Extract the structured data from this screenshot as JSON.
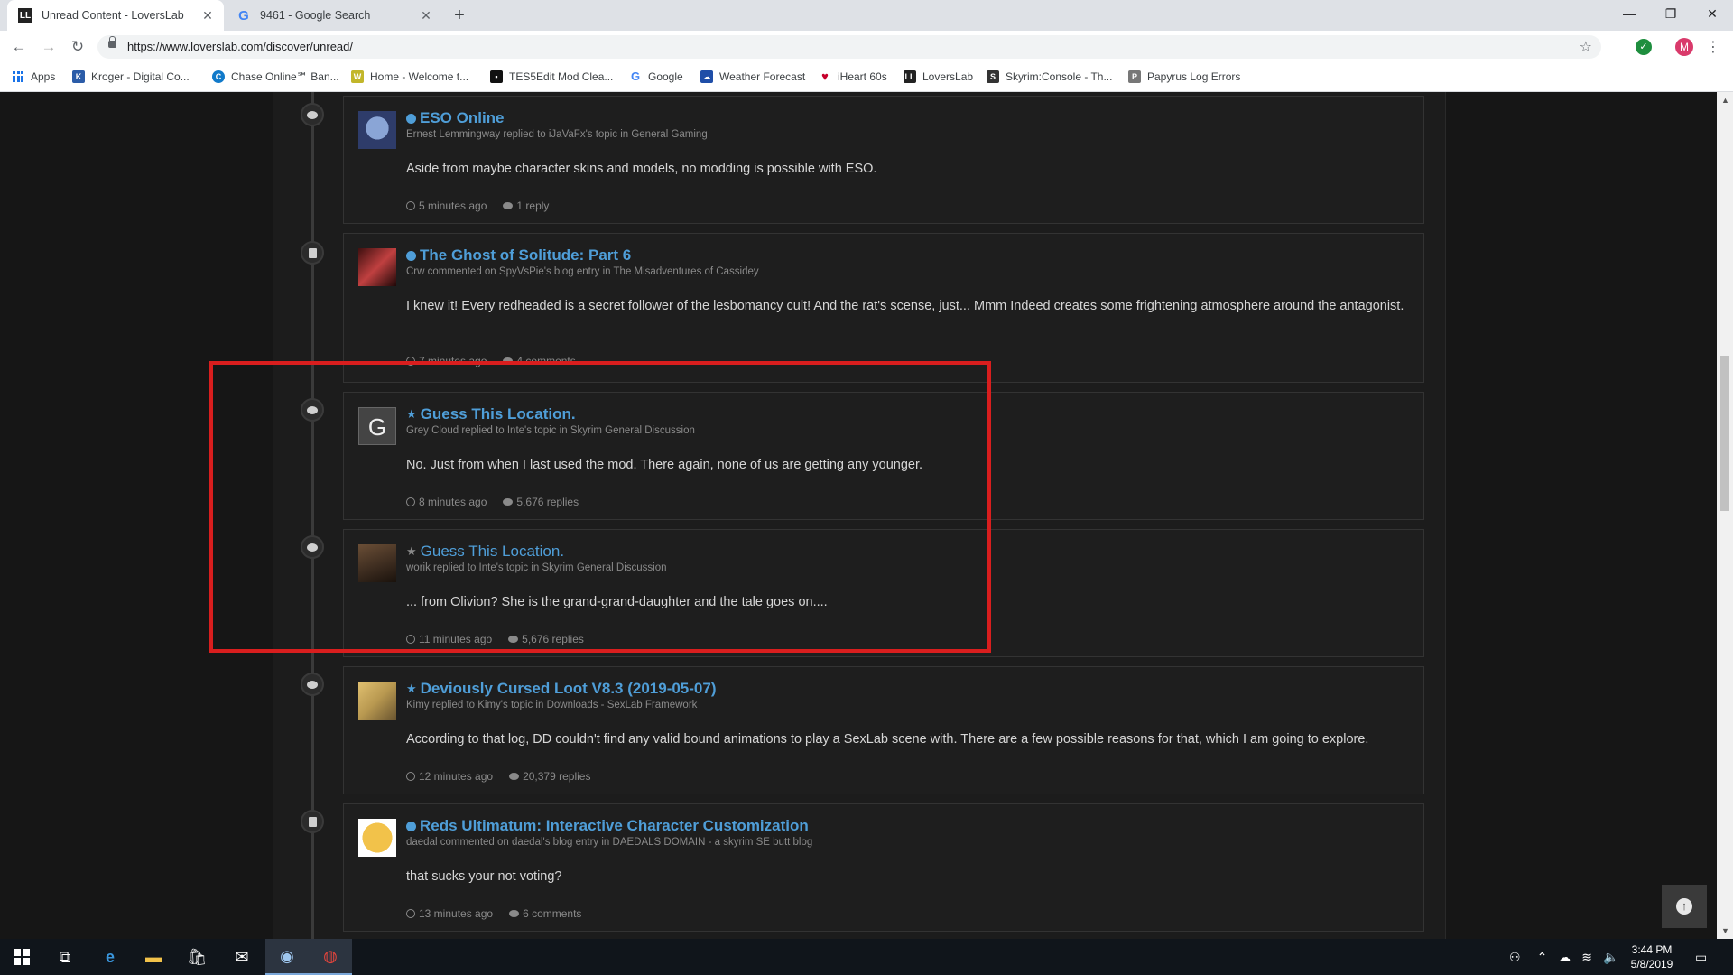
{
  "browser": {
    "tabs": [
      {
        "title": "Unread Content - LoversLab",
        "icon": "loverslab-favicon",
        "active": true
      },
      {
        "title": "9461 - Google Search",
        "icon": "google-favicon",
        "active": false
      }
    ],
    "url": "https://www.loverslab.com/discover/unread/",
    "profile_initial": "M",
    "bookmarks": [
      {
        "label": "Apps"
      },
      {
        "label": "Kroger - Digital Co..."
      },
      {
        "label": "Chase Online℠ Ban..."
      },
      {
        "label": "Home - Welcome t..."
      },
      {
        "label": "TES5Edit Mod Clea..."
      },
      {
        "label": "Google"
      },
      {
        "label": "Weather Forecast"
      },
      {
        "label": "iHeart 60s"
      },
      {
        "label": "LoversLab"
      },
      {
        "label": "Skyrim:Console - Th..."
      },
      {
        "label": "Papyrus Log Errors"
      }
    ]
  },
  "feed": {
    "items": [
      {
        "type": "comment",
        "marker": "unread-dot",
        "title": "ESO Online",
        "meta": "Ernest Lemmingway replied to iJaVaFx's topic in General Gaming",
        "snippet": "Aside from maybe character skins and models, no modding is possible with ESO.",
        "time": "5 minutes ago",
        "replies": "1 reply"
      },
      {
        "type": "blog",
        "marker": "unread-dot",
        "title": "The Ghost of Solitude: Part 6",
        "meta": "Crw commented on SpyVsPie's blog entry in The Misadventures of Cassidey",
        "snippet": "I knew it! Every redheaded is a secret follower of the lesbomancy cult! And the rat's scense, just... Mmm Indeed creates some frightening atmosphere around the antagonist.",
        "time": "7 minutes ago",
        "replies": "4 comments"
      },
      {
        "type": "comment",
        "marker": "star",
        "title": "Guess This Location.",
        "avatar_letter": "G",
        "meta": "Grey Cloud replied to Inte's topic in Skyrim General Discussion",
        "snippet": "No. Just from when I last used the mod. There again, none of us are getting any younger.",
        "time": "8 minutes ago",
        "replies": "5,676 replies"
      },
      {
        "type": "comment",
        "marker": "star",
        "title": "Guess This Location.",
        "meta": "worik replied to Inte's topic in Skyrim General Discussion",
        "snippet": "... from Olivion? She is the grand-grand-daughter and the tale goes on....",
        "time": "11 minutes ago",
        "replies": "5,676 replies"
      },
      {
        "type": "comment",
        "marker": "star",
        "title": "Deviously Cursed Loot V8.3 (2019-05-07)",
        "meta": "Kimy replied to Kimy's topic in Downloads - SexLab Framework",
        "snippet": "According to that log, DD couldn't find any valid bound animations to play a SexLab scene with. There are a few possible reasons for that, which I am going to explore.",
        "time": "12 minutes ago",
        "replies": "20,379 replies"
      },
      {
        "type": "blog",
        "marker": "unread-dot",
        "title": "Reds Ultimatum: Interactive Character Customization",
        "meta": "daedal commented on daedal's blog entry in DAEDALS DOMAIN - a skyrim SE butt blog",
        "snippet": "that sucks your not voting?",
        "time": "13 minutes ago",
        "replies": "6 comments"
      }
    ]
  },
  "colors": {
    "accent": "#4f9ed8",
    "highlight": "#d91e1e",
    "page_bg": "#161616",
    "card_bg": "#1e1e1e"
  },
  "taskbar": {
    "time": "3:44 PM",
    "date": "5/8/2019",
    "apps": [
      "windows-start",
      "task-view",
      "edge",
      "file-explorer",
      "store",
      "mail",
      "steam",
      "chrome"
    ]
  }
}
